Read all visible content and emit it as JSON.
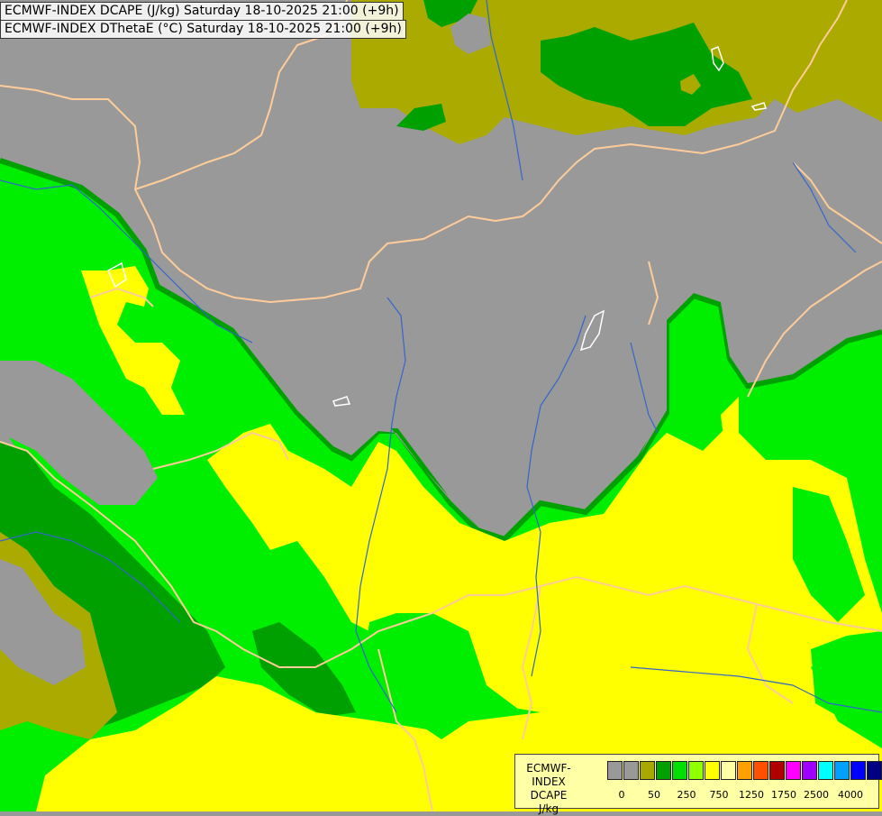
{
  "titles": {
    "line1": "ECMWF-INDEX DCAPE (J/kg) Saturday 18-10-2025 21:00 (+9h)",
    "line2": "ECMWF-INDEX DThetaE (°C) Saturday 18-10-2025 21:00 (+9h)"
  },
  "legend": {
    "label_line1": "ECMWF-INDEX",
    "label_line2": "DCAPE",
    "label_line3": "J/kg",
    "tick_labels": [
      "0",
      "50",
      "250",
      "750",
      "1250",
      "1750",
      "2500",
      "4000"
    ],
    "swatch_colors": [
      "#999999",
      "#999999",
      "#a8a800",
      "#00a000",
      "#00e000",
      "#90ff00",
      "#ffff00",
      "#ffffa6",
      "#ffa000",
      "#ff5000",
      "#b00000",
      "#ff00ff",
      "#a000ff",
      "#00ffff",
      "#00a0ff",
      "#0000ff",
      "#000080"
    ]
  },
  "colors": {
    "background_gray": "#999999",
    "olive": "#aaaa00",
    "dark_green": "#00a000",
    "mid_green": "#00cc00",
    "light_green": "#00ee00",
    "yellow": "#ffff00",
    "pale_yellow": "#ffffa0",
    "border_lines": "#ffcc99",
    "rivers": "#3366cc"
  }
}
